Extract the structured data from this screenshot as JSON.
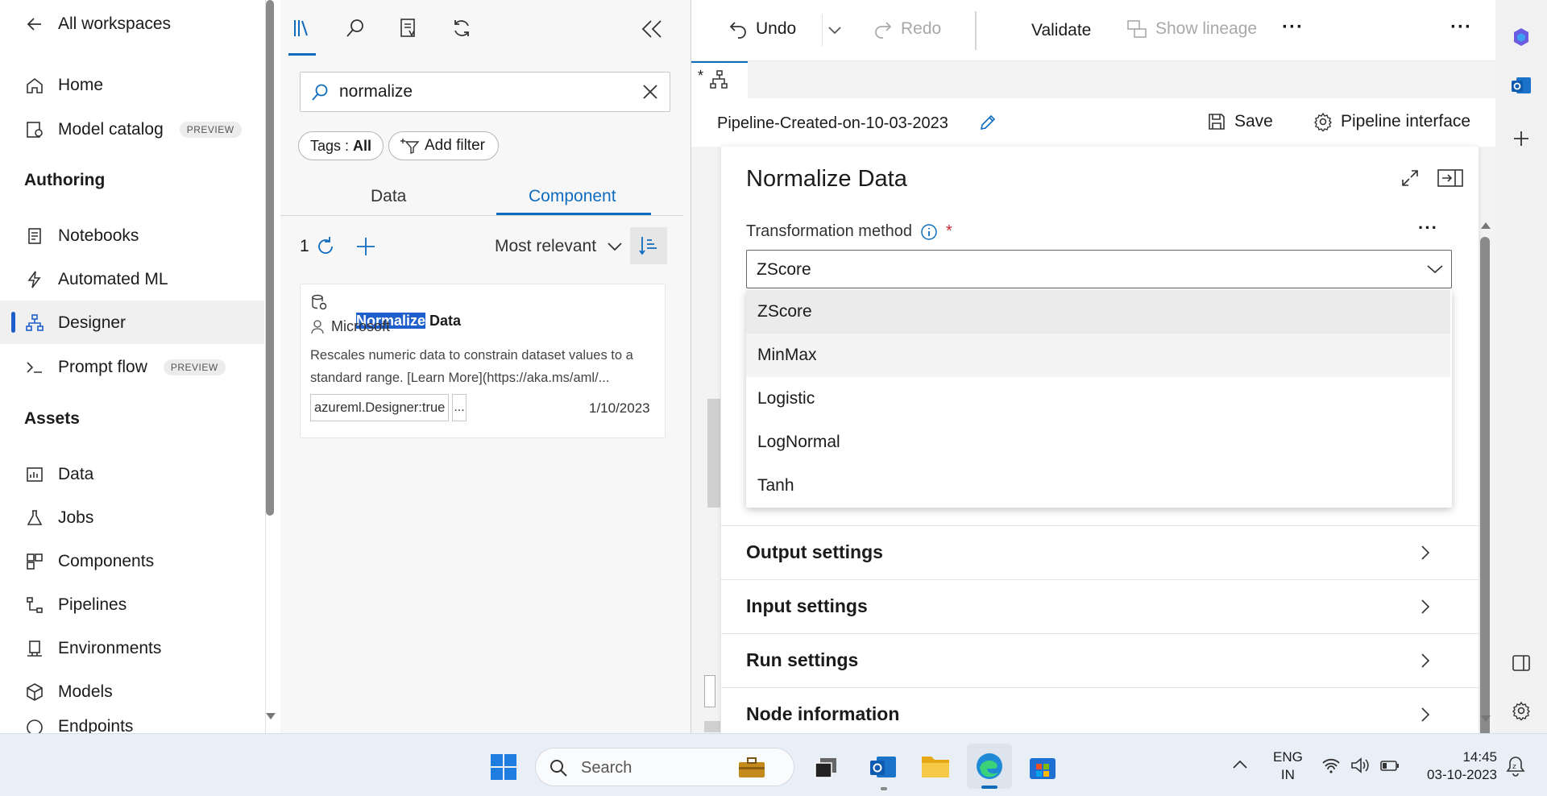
{
  "leftnav": {
    "back_label": "All workspaces",
    "items": [
      {
        "label": "Home",
        "icon": "home-icon"
      },
      {
        "label": "Model catalog",
        "icon": "model-catalog-icon",
        "badge": "PREVIEW"
      },
      {
        "label": "Notebooks",
        "icon": "notebook-icon"
      },
      {
        "label": "Automated ML",
        "icon": "automl-icon"
      },
      {
        "label": "Designer",
        "icon": "designer-icon",
        "selected": true
      },
      {
        "label": "Prompt flow",
        "icon": "prompt-flow-icon",
        "badge": "PREVIEW"
      },
      {
        "label": "Data",
        "icon": "data-icon"
      },
      {
        "label": "Jobs",
        "icon": "jobs-icon"
      },
      {
        "label": "Components",
        "icon": "components-icon"
      },
      {
        "label": "Pipelines",
        "icon": "pipelines-icon"
      },
      {
        "label": "Environments",
        "icon": "environments-icon"
      },
      {
        "label": "Models",
        "icon": "models-icon"
      },
      {
        "label": "Endpoints",
        "icon": "endpoints-icon"
      }
    ],
    "sections": {
      "authoring": "Authoring",
      "assets": "Assets"
    },
    "accent": "#1f5fcc"
  },
  "library": {
    "search_value": "normalize",
    "tags_label": "Tags : ",
    "tags_value": "All",
    "add_filter_label": "Add filter",
    "tabs": [
      "Data",
      "Component"
    ],
    "active_tab": "Component",
    "result_count": "1",
    "sort_label": "Most relevant",
    "card": {
      "title_highlight": "Normalize",
      "title_rest": " Data",
      "author": "Microsoft",
      "description": "Rescales numeric data to constrain dataset values to a standard range. [Learn More](https://aka.ms/aml/...",
      "tag": "azureml.Designer:true",
      "more": "...",
      "date": "1/10/2023"
    }
  },
  "toolbar": {
    "undo": "Undo",
    "redo": "Redo",
    "validate": "Validate",
    "show_lineage": "Show lineage",
    "more": "···"
  },
  "pipeline": {
    "name": "Pipeline-Created-on-10-03-2023",
    "save": "Save",
    "interface": "Pipeline interface",
    "tab_label": "*"
  },
  "properties": {
    "title": "Normalize Data",
    "field_label": "Transformation method",
    "required_mark": "*",
    "selected_value": "ZScore",
    "options": [
      "ZScore",
      "MinMax",
      "Logistic",
      "LogNormal",
      "Tanh"
    ],
    "highlighted_option": "MinMax",
    "sections": [
      "Output settings",
      "Input settings",
      "Run settings",
      "Node information"
    ]
  },
  "taskbar": {
    "search_placeholder": "Search",
    "lang_line1": "ENG",
    "lang_line2": "IN",
    "time": "14:45",
    "date": "03-10-2023"
  }
}
